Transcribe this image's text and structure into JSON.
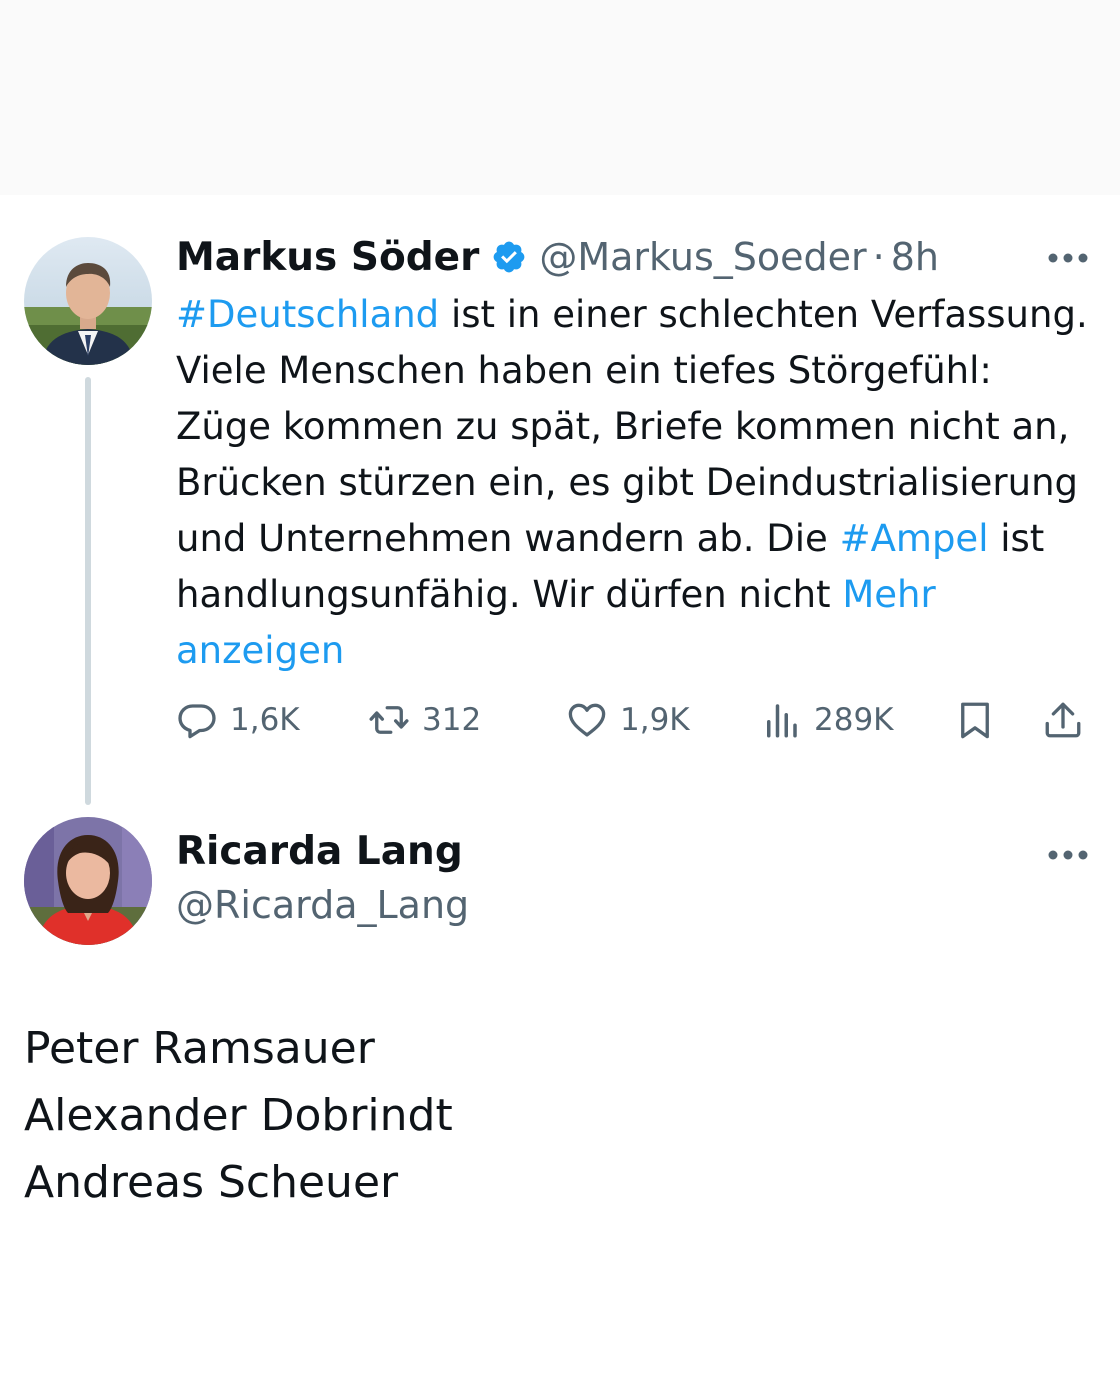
{
  "colors": {
    "accent": "#1d9bf0",
    "secondary_text": "#536471",
    "thread_line": "#cfd9de",
    "primary_text": "#0f1419"
  },
  "tweet": {
    "author": {
      "name": "Markus Söder",
      "handle": "@Markus_Soeder",
      "separator": "·",
      "time": "8h",
      "verified": true,
      "verified_icon": "verified-badge-icon"
    },
    "text": {
      "hashtag_1": "#Deutschland",
      "part_1": " ist in einer schlechten Verfassung. Viele Menschen haben ein tiefes Störgefühl: Züge kommen zu spät, Briefe kommen nicht an, Brücken stürzen ein, es gibt Deindustrialisierung und Unternehmen wandern ab. Die ",
      "hashtag_2": "#Ampel",
      "part_2": " ist handlungsunfähig. Wir dürfen nicht ",
      "show_more": "Mehr anzeigen"
    },
    "stats": {
      "replies": "1,6K",
      "retweets": "312",
      "likes": "1,9K",
      "views": "289K"
    },
    "icons": {
      "reply": "reply-icon",
      "retweet": "retweet-icon",
      "like": "heart-icon",
      "views": "views-icon",
      "bookmark": "bookmark-icon",
      "share": "share-icon",
      "more": "more-icon"
    }
  },
  "reply": {
    "author": {
      "name": "Ricarda Lang",
      "handle": "@Ricarda_Lang"
    },
    "lines": [
      "Peter Ramsauer",
      "Alexander Dobrindt",
      "Andreas Scheuer"
    ]
  }
}
